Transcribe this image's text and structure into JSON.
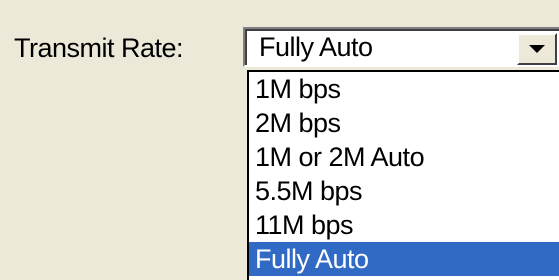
{
  "transmit_rate": {
    "label": "Transmit Rate:",
    "selected_value": "Fully Auto",
    "dropdown_icon": "chevron-down-icon",
    "options": [
      {
        "label": "1M bps",
        "selected": false
      },
      {
        "label": "2M bps",
        "selected": false
      },
      {
        "label": "1M or 2M Auto",
        "selected": false
      },
      {
        "label": "5.5M bps",
        "selected": false
      },
      {
        "label": "11M bps",
        "selected": false
      },
      {
        "label": "Fully Auto",
        "selected": true
      }
    ]
  },
  "colors": {
    "dialog_background": "#ece9d8",
    "list_background": "#ffffff",
    "selection_highlight": "#316ac5",
    "selection_text": "#ffffff"
  }
}
